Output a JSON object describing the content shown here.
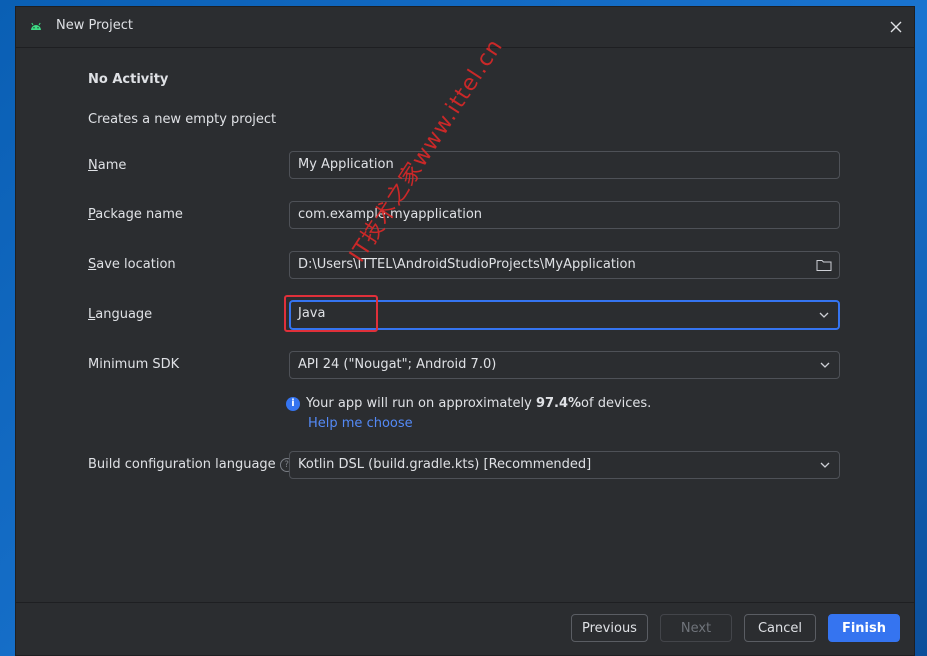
{
  "window": {
    "title": "New Project"
  },
  "template": {
    "heading": "No Activity",
    "description": "Creates a new empty project"
  },
  "form": {
    "name": {
      "label_mnemonic": "N",
      "label_rest": "ame",
      "value": "My Application"
    },
    "package": {
      "label_mnemonic": "P",
      "label_rest": "ackage name",
      "value": "com.example.myapplication"
    },
    "save_location": {
      "label_mnemonic": "S",
      "label_rest": "ave location",
      "value": "D:\\Users\\ITTEL\\AndroidStudioProjects\\MyApplication"
    },
    "language": {
      "label_mnemonic": "L",
      "label_rest": "anguage",
      "value": "Java"
    },
    "min_sdk": {
      "label": "Minimum SDK",
      "value": "API 24 (\"Nougat\"; Android 7.0)"
    },
    "info": {
      "prefix": "Your app will run on approximately ",
      "percent": "97.4%",
      "suffix": " of devices.",
      "help_link": "Help me choose"
    },
    "build_config": {
      "label": "Build configuration language",
      "value": "Kotlin DSL (build.gradle.kts) [Recommended]"
    }
  },
  "buttons": {
    "previous": "Previous",
    "next": "Next",
    "cancel": "Cancel",
    "finish": "Finish"
  },
  "watermark": "IT技术之家www.ittel.cn",
  "colors": {
    "accent": "#3574f0",
    "highlight": "#e0303a",
    "background": "#2b2d30"
  }
}
